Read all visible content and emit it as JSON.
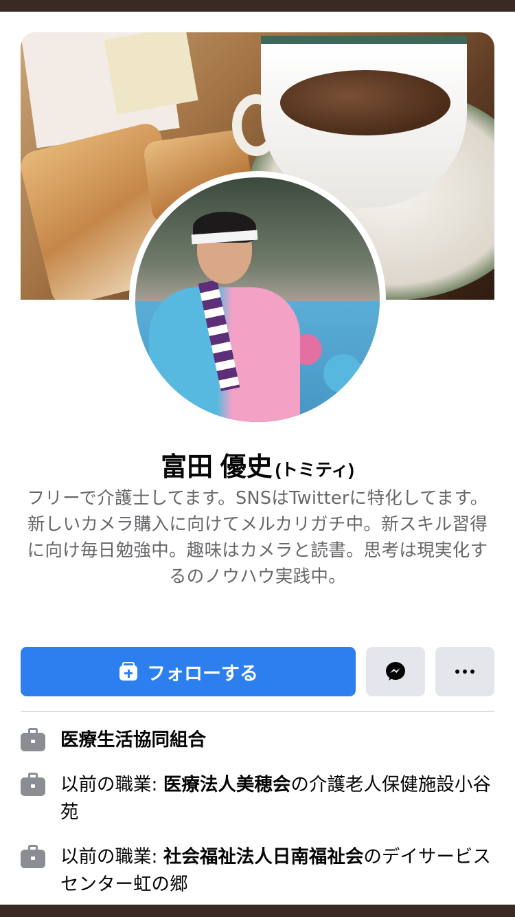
{
  "profile": {
    "name": "富田 優史",
    "nickname": "(トミティ)",
    "bio": "フリーで介護士してます。SNSはTwitterに特化してます。新しいカメラ購入に向けてメルカリガチ中。新スキル習得に向け毎日勉強中。趣味はカメラと読書。思考は現実化するのノウハウ実践中。"
  },
  "actions": {
    "follow_label": "フォローする",
    "follow_icon": "follow-plus-icon",
    "message_icon": "messenger-icon",
    "more_icon": "more-dots-icon"
  },
  "work": [
    {
      "icon": "briefcase-icon",
      "prefix": "",
      "org": "医療生活協同組合",
      "suffix": ""
    },
    {
      "icon": "briefcase-icon",
      "prefix": "以前の職業: ",
      "org": "医療法人美穂会",
      "suffix": "の介護老人保健施設小谷苑"
    },
    {
      "icon": "briefcase-icon",
      "prefix": "以前の職業: ",
      "org": "社会福祉法人日南福祉会",
      "suffix": "のデイサービスセンター虹の郷"
    }
  ],
  "colors": {
    "primary_button": "#2d7ff0",
    "secondary_button": "#e4e6eb",
    "secondary_text": "#65676b",
    "frame": "#3a2a26"
  }
}
